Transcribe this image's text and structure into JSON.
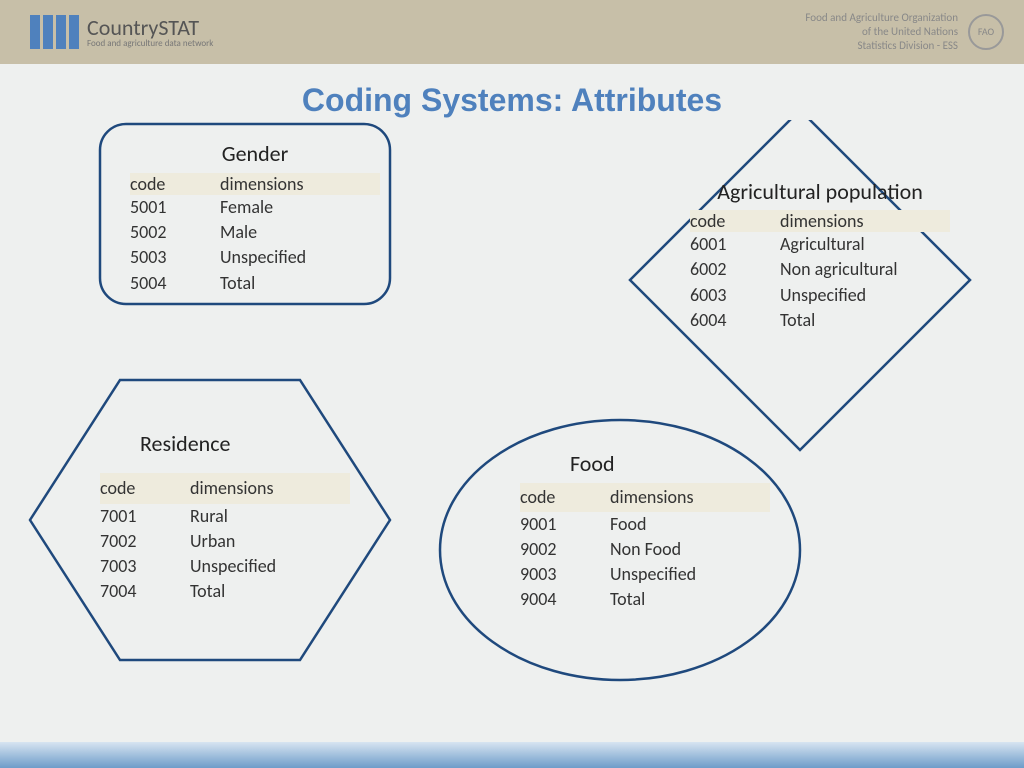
{
  "header": {
    "logo_title": "CountrySTAT",
    "logo_subtitle": "Food and agriculture data network",
    "fao_line1": "Food and Agriculture Organization",
    "fao_line2": "of the United Nations",
    "fao_line3": "Statistics Division - ESS",
    "fao_badge": "FAO"
  },
  "title": "Coding Systems: Attributes",
  "columns": {
    "code": "code",
    "dimensions": "dimensions"
  },
  "gender": {
    "title": "Gender",
    "rows": [
      {
        "code": "5001",
        "dim": "Female"
      },
      {
        "code": "5002",
        "dim": "Male"
      },
      {
        "code": "5003",
        "dim": "Unspecified"
      },
      {
        "code": "5004",
        "dim": "Total"
      }
    ]
  },
  "agri": {
    "title": "Agricultural population",
    "rows": [
      {
        "code": "6001",
        "dim": "Agricultural"
      },
      {
        "code": "6002",
        "dim": "Non agricultural"
      },
      {
        "code": "6003",
        "dim": "Unspecified"
      },
      {
        "code": "6004",
        "dim": "Total"
      }
    ]
  },
  "residence": {
    "title": "Residence",
    "rows": [
      {
        "code": "7001",
        "dim": "Rural"
      },
      {
        "code": "7002",
        "dim": "Urban"
      },
      {
        "code": "7003",
        "dim": "Unspecified"
      },
      {
        "code": "7004",
        "dim": "Total"
      }
    ]
  },
  "food": {
    "title": "Food",
    "rows": [
      {
        "code": "9001",
        "dim": "Food"
      },
      {
        "code": "9002",
        "dim": "Non Food"
      },
      {
        "code": "9003",
        "dim": "Unspecified"
      },
      {
        "code": "9004",
        "dim": "Total"
      }
    ]
  }
}
